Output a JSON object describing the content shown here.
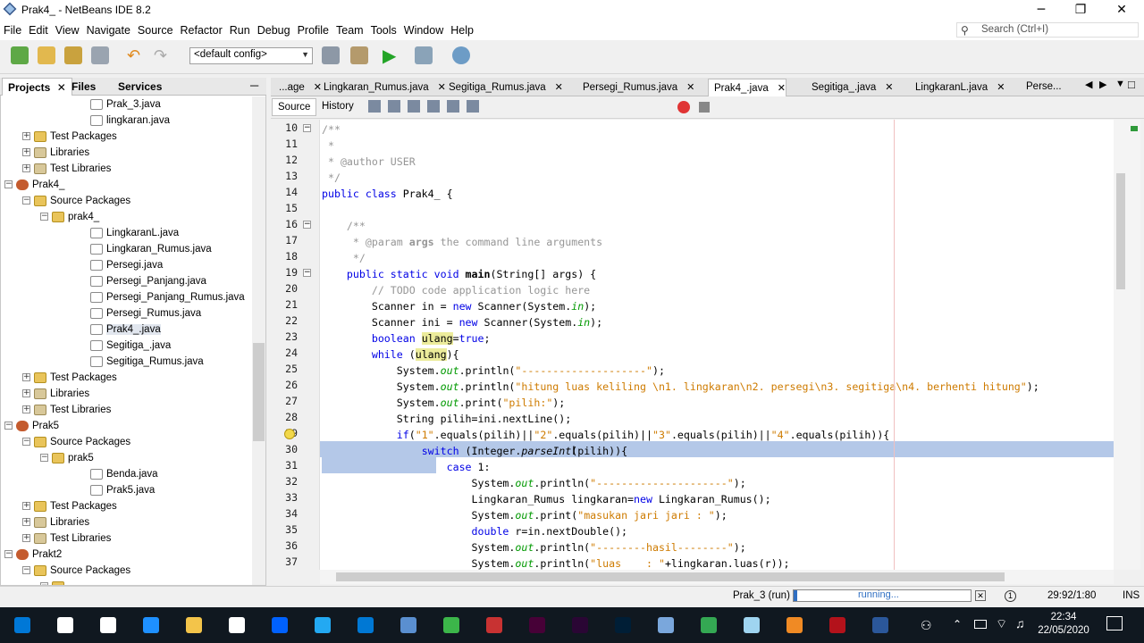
{
  "window": {
    "title": "Prak4_ - NetBeans IDE 8.2",
    "minimize": "─",
    "maximize": "❐",
    "close": "✕"
  },
  "menu": [
    "File",
    "Edit",
    "View",
    "Navigate",
    "Source",
    "Refactor",
    "Run",
    "Debug",
    "Profile",
    "Team",
    "Tools",
    "Window",
    "Help"
  ],
  "search": {
    "placeholder": "Search (Ctrl+I)"
  },
  "toolbar": {
    "config": "<default config>"
  },
  "left_panel": {
    "tabs": [
      "Projects",
      "Files",
      "Services"
    ],
    "tree": [
      {
        "label": "Prak_3.java",
        "type": "jav",
        "level": 4
      },
      {
        "label": "lingkaran.java",
        "type": "jav",
        "level": 4
      },
      {
        "label": "Test Packages",
        "type": "pkg",
        "level": 2,
        "exp": "+"
      },
      {
        "label": "Libraries",
        "type": "lib",
        "level": 2,
        "exp": "+"
      },
      {
        "label": "Test Libraries",
        "type": "lib",
        "level": 2,
        "exp": "+"
      },
      {
        "label": "Prak4_",
        "type": "prj",
        "level": 1,
        "exp": "−"
      },
      {
        "label": "Source Packages",
        "type": "pkg",
        "level": 2,
        "exp": "−"
      },
      {
        "label": "prak4_",
        "type": "pkg",
        "level": 3,
        "exp": "−"
      },
      {
        "label": "LingkaranL.java",
        "type": "jav",
        "level": 4
      },
      {
        "label": "Lingkaran_Rumus.java",
        "type": "jav",
        "level": 4
      },
      {
        "label": "Persegi.java",
        "type": "jav",
        "level": 4
      },
      {
        "label": "Persegi_Panjang.java",
        "type": "jav",
        "level": 4
      },
      {
        "label": "Persegi_Panjang_Rumus.java",
        "type": "jav",
        "level": 4
      },
      {
        "label": "Persegi_Rumus.java",
        "type": "jav",
        "level": 4
      },
      {
        "label": "Prak4_.java",
        "type": "jav",
        "level": 4,
        "sel": true
      },
      {
        "label": "Segitiga_.java",
        "type": "jav",
        "level": 4
      },
      {
        "label": "Segitiga_Rumus.java",
        "type": "jav",
        "level": 4
      },
      {
        "label": "Test Packages",
        "type": "pkg",
        "level": 2,
        "exp": "+"
      },
      {
        "label": "Libraries",
        "type": "lib",
        "level": 2,
        "exp": "+"
      },
      {
        "label": "Test Libraries",
        "type": "lib",
        "level": 2,
        "exp": "+"
      },
      {
        "label": "Prak5",
        "type": "prj",
        "level": 1,
        "exp": "−"
      },
      {
        "label": "Source Packages",
        "type": "pkg",
        "level": 2,
        "exp": "−"
      },
      {
        "label": "prak5",
        "type": "pkg",
        "level": 3,
        "exp": "−"
      },
      {
        "label": "Benda.java",
        "type": "jav",
        "level": 4
      },
      {
        "label": "Prak5.java",
        "type": "jav",
        "level": 4
      },
      {
        "label": "Test Packages",
        "type": "pkg",
        "level": 2,
        "exp": "+"
      },
      {
        "label": "Libraries",
        "type": "lib",
        "level": 2,
        "exp": "+"
      },
      {
        "label": "Test Libraries",
        "type": "lib",
        "level": 2,
        "exp": "+"
      },
      {
        "label": "Prakt2",
        "type": "prj",
        "level": 1,
        "exp": "−"
      },
      {
        "label": "Source Packages",
        "type": "pkg",
        "level": 2,
        "exp": "−"
      },
      {
        "label": "",
        "type": "pkg",
        "level": 3,
        "exp": "−"
      }
    ]
  },
  "editor": {
    "tabs": [
      {
        "label": "...age"
      },
      {
        "label": "Lingkaran_Rumus.java"
      },
      {
        "label": "Segitiga_Rumus.java"
      },
      {
        "label": "Persegi_Rumus.java"
      },
      {
        "label": "Prak4_.java",
        "active": true
      },
      {
        "label": "Segitiga_.java"
      },
      {
        "label": "LingkaranL.java"
      },
      {
        "label": "Perse..."
      }
    ],
    "source_tab": "Source",
    "history_tab": "History",
    "lines": [
      {
        "n": "10",
        "fold": "−",
        "html": "<span class='c-com'>/**</span>"
      },
      {
        "n": "11",
        "html": "<span class='c-com'> *</span>"
      },
      {
        "n": "12",
        "html": "<span class='c-com'> * @author USER</span>"
      },
      {
        "n": "13",
        "html": "<span class='c-com'> */</span>"
      },
      {
        "n": "14",
        "html": "<span class='c-kw'>public class</span> Prak4_ {"
      },
      {
        "n": "15",
        "html": ""
      },
      {
        "n": "16",
        "fold": "−",
        "html": "    <span class='c-com'>/**</span>"
      },
      {
        "n": "17",
        "html": "<span class='c-com'>     * @param <b>args</b> the command line arguments</span>"
      },
      {
        "n": "18",
        "html": "<span class='c-com'>     */</span>"
      },
      {
        "n": "19",
        "fold": "−",
        "html": "    <span class='c-kw'>public static void</span> <span class='c-mb'>main</span>(String[] args) {"
      },
      {
        "n": "20",
        "html": "        <span class='c-com'>// TODO code application logic here</span>"
      },
      {
        "n": "21",
        "html": "        Scanner in = <span class='c-kw'>new</span> Scanner(System.<span class='c-fld'>in</span>);"
      },
      {
        "n": "22",
        "html": "        Scanner ini = <span class='c-kw'>new</span> Scanner(System.<span class='c-fld'>in</span>);"
      },
      {
        "n": "23",
        "html": "        <span class='c-kw'>boolean</span> <span class='c-hl'>ulang</span>=<span class='c-kw'>true</span>;"
      },
      {
        "n": "24",
        "html": "        <span class='c-kw'>while</span> (<span class='c-hl'>ulang</span>){"
      },
      {
        "n": "25",
        "html": "            System.<span class='c-fld'>out</span>.println(<span class='c-str'>\"--------------------\"</span>);"
      },
      {
        "n": "26",
        "html": "            System.<span class='c-fld'>out</span>.println(<span class='c-str'>\"hitung luas keliling \\n1. lingkaran\\n2. persegi\\n3. segitiga\\n4. berhenti hitung\"</span>);"
      },
      {
        "n": "27",
        "html": "            System.<span class='c-fld'>out</span>.print(<span class='c-str'>\"pilih:\"</span>);"
      },
      {
        "n": "28",
        "html": "            String pilih=ini.nextLine();"
      },
      {
        "n": "29",
        "html": "            <span class='c-kw'>if</span>(<span class='c-str'>\"1\"</span>.equals(pilih)||<span class='c-str'>\"2\"</span>.equals(pilih)||<span class='c-str'>\"3\"</span>.equals(pilih)||<span class='c-str'>\"4\"</span>.equals(pilih)){"
      },
      {
        "n": "30",
        "html": "                <span class='c-kw'>switch</span> (Integer.<i>parseInt</i>(pilih)){"
      },
      {
        "n": "31",
        "html": "                    <span class='c-kw'>case</span> 1:"
      },
      {
        "n": "32",
        "html": "                        System.<span class='c-fld'>out</span>.println(<span class='c-str'>\"---------------------\"</span>);"
      },
      {
        "n": "33",
        "html": "                        Lingkaran_Rumus lingkaran=<span class='c-kw'>new</span> Lingkaran_Rumus();"
      },
      {
        "n": "34",
        "html": "                        System.<span class='c-fld'>out</span>.print(<span class='c-str'>\"masukan jari jari : \"</span>);"
      },
      {
        "n": "35",
        "html": "                        <span class='c-kw'>double</span> r=in.nextDouble();"
      },
      {
        "n": "36",
        "html": "                        System.<span class='c-fld'>out</span>.println(<span class='c-str'>\"--------hasil--------\"</span>);"
      },
      {
        "n": "37",
        "html": "                        System.<span class='c-fld'>out</span>.println(<span class='c-str'>\"luas    : \"</span>+lingkaran.luas(r));"
      }
    ]
  },
  "status": {
    "task": "Prak_3 (run)",
    "running": "running...",
    "progress": 0.02,
    "position": "29:92/1:80",
    "mode": "INS"
  },
  "taskbar": {
    "time": "22:34",
    "date": "22/05/2020",
    "apps": [
      "start-icon",
      "search-icon",
      "task-view-icon",
      "edge-icon",
      "explorer-icon",
      "store-icon",
      "dropbox-icon",
      "vscode-icon",
      "mail-icon",
      "app-icon",
      "spreadsheet-icon",
      "game-icon",
      "xd-icon",
      "premiere-icon",
      "photoshop-icon",
      "netbeans-icon",
      "chrome-icon",
      "notepad-icon",
      "vlc-icon",
      "reader-icon",
      "word-icon"
    ],
    "colors": [
      "#0078d7",
      "#ffffff",
      "#ffffff",
      "#1e90ff",
      "#f3c44a",
      "#ffffff",
      "#0061fe",
      "#23a9f2",
      "#0078d4",
      "#5a8fd0",
      "#3cb64a",
      "#c83232",
      "#470137",
      "#2a0634",
      "#001e36",
      "#7aa7dc",
      "#34a853",
      "#9fd4f0",
      "#f08a24",
      "#b3121b",
      "#2b579a"
    ]
  }
}
